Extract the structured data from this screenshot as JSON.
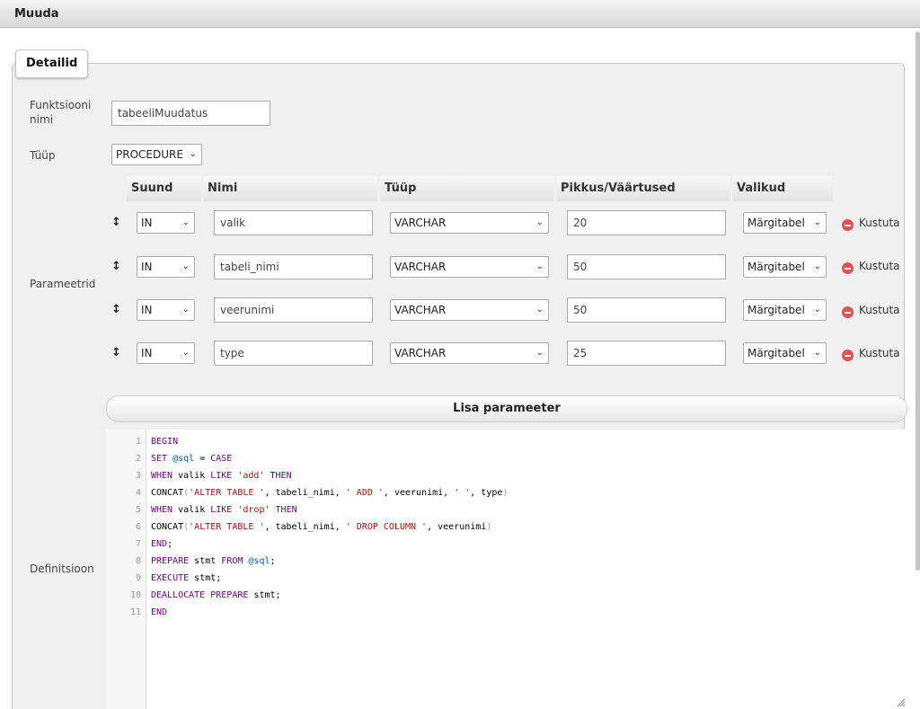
{
  "window": {
    "title": "Muuda"
  },
  "tab": {
    "label": "Detailid"
  },
  "form": {
    "name_label": "Funktsiooni nimi",
    "name_value": "tabeeliMuudatus",
    "type_label": "Tüüp",
    "type_value": "PROCEDURE",
    "params_label": "Parameetrid",
    "def_label": "Definitsioon"
  },
  "params": {
    "headers": [
      "Suund",
      "Nimi",
      "Tüüp",
      "Pikkus/Väärtused",
      "Valikud"
    ],
    "delete_label": "Kustuta",
    "add_label": "Lisa parameeter",
    "rows": [
      {
        "dir": "IN",
        "name": "valik",
        "type": "VARCHAR",
        "length": "20",
        "option": "Märgitabel"
      },
      {
        "dir": "IN",
        "name": "tabeli_nimi",
        "type": "VARCHAR",
        "length": "50",
        "option": "Märgitabel"
      },
      {
        "dir": "IN",
        "name": "veerunimi",
        "type": "VARCHAR",
        "length": "50",
        "option": "Märgitabel"
      },
      {
        "dir": "IN",
        "name": "type",
        "type": "VARCHAR",
        "length": "25",
        "option": "Märgitabel"
      }
    ]
  },
  "code": {
    "line_numbers": [
      "1",
      "2",
      "3",
      "4",
      "5",
      "6",
      "7",
      "8",
      "9",
      "10",
      "11"
    ],
    "lines": [
      "BEGIN",
      "SET @sql = CASE",
      "WHEN valik LIKE 'add' THEN",
      "CONCAT('ALTER TABLE ', tabeli_nimi, ' ADD ', veerunimi, ' ', type)",
      "WHEN valik LIKE 'drop' THEN",
      "CONCAT('ALTER TABLE ', tabeli_nimi, ' DROP COLUMN ', veerunimi)",
      "END;",
      "PREPARE stmt FROM @sql;",
      "EXECUTE stmt;",
      "DEALLOCATE PREPARE stmt;",
      "END"
    ]
  },
  "colors": {
    "keyword": "#770088",
    "string": "#aa1111",
    "variable": "#0055aa",
    "delete": "#e35151"
  }
}
